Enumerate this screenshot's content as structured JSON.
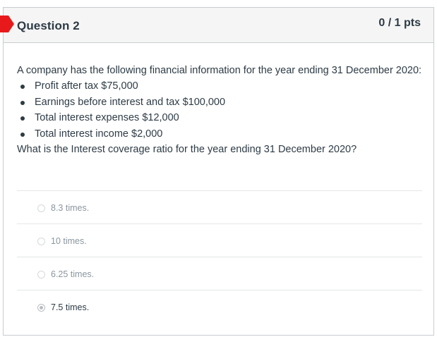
{
  "header": {
    "title": "Question 2",
    "points": "0 / 1 pts",
    "flag_color": "#e8191a"
  },
  "question": {
    "intro": "A company has the following financial information for the year ending 31 December 2020:",
    "facts": [
      "Profit after tax $75,000",
      "Earnings before interest and tax $100,000",
      "Total interest expenses $12,000",
      "Total interest income $2,000"
    ],
    "prompt": "What is the Interest coverage ratio for the year ending 31 December 2020?"
  },
  "answers": [
    {
      "label": "8.3 times.",
      "selected": false
    },
    {
      "label": "10 times.",
      "selected": false
    },
    {
      "label": "6.25 times.",
      "selected": false
    },
    {
      "label": "7.5 times.",
      "selected": true
    }
  ]
}
